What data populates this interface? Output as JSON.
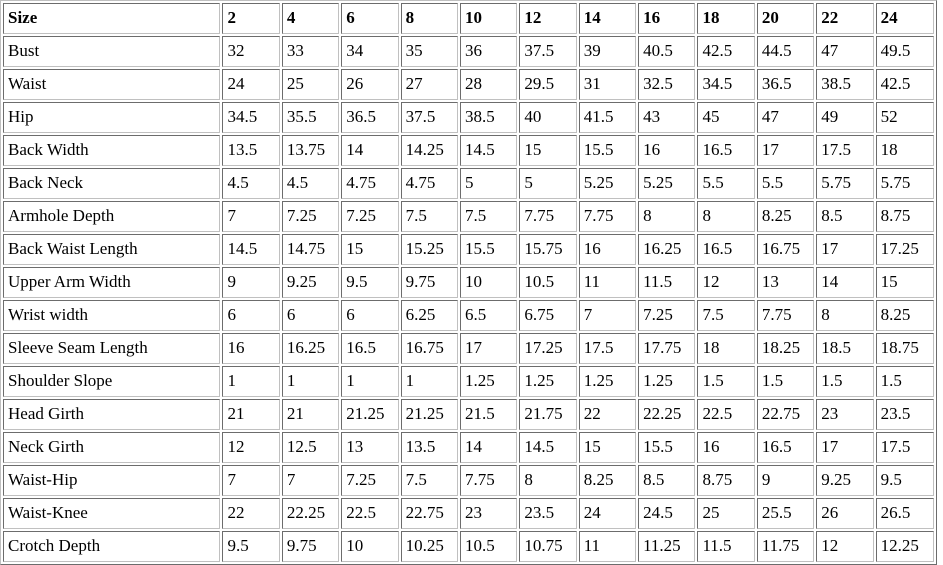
{
  "table": {
    "label_header": "Size",
    "size_headers": [
      "2",
      "4",
      "6",
      "8",
      "10",
      "12",
      "14",
      "16",
      "18",
      "20",
      "22",
      "24"
    ],
    "rows": [
      {
        "label": "Bust",
        "values": [
          "32",
          "33",
          "34",
          "35",
          "36",
          "37.5",
          "39",
          "40.5",
          "42.5",
          "44.5",
          "47",
          "49.5"
        ]
      },
      {
        "label": "Waist",
        "values": [
          "24",
          "25",
          "26",
          "27",
          "28",
          "29.5",
          "31",
          "32.5",
          "34.5",
          "36.5",
          "38.5",
          "42.5"
        ]
      },
      {
        "label": "Hip",
        "values": [
          "34.5",
          "35.5",
          "36.5",
          "37.5",
          "38.5",
          "40",
          "41.5",
          "43",
          "45",
          "47",
          "49",
          "52"
        ]
      },
      {
        "label": "Back Width",
        "values": [
          "13.5",
          "13.75",
          "14",
          "14.25",
          "14.5",
          "15",
          "15.5",
          "16",
          "16.5",
          "17",
          "17.5",
          "18"
        ]
      },
      {
        "label": "Back Neck",
        "values": [
          "4.5",
          "4.5",
          "4.75",
          "4.75",
          "5",
          "5",
          "5.25",
          "5.25",
          "5.5",
          "5.5",
          "5.75",
          "5.75"
        ]
      },
      {
        "label": "Armhole Depth",
        "values": [
          "7",
          "7.25",
          "7.25",
          "7.5",
          "7.5",
          "7.75",
          "7.75",
          "8",
          "8",
          "8.25",
          "8.5",
          "8.75"
        ]
      },
      {
        "label": "Back Waist Length",
        "values": [
          "14.5",
          "14.75",
          "15",
          "15.25",
          "15.5",
          "15.75",
          "16",
          "16.25",
          "16.5",
          "16.75",
          "17",
          "17.25"
        ]
      },
      {
        "label": "Upper Arm Width",
        "values": [
          "9",
          "9.25",
          "9.5",
          "9.75",
          "10",
          "10.5",
          "11",
          "11.5",
          "12",
          "13",
          "14",
          "15"
        ]
      },
      {
        "label": "Wrist width",
        "values": [
          "6",
          "6",
          "6",
          "6.25",
          "6.5",
          "6.75",
          "7",
          "7.25",
          "7.5",
          "7.75",
          "8",
          "8.25"
        ]
      },
      {
        "label": "Sleeve Seam Length",
        "values": [
          "16",
          "16.25",
          "16.5",
          "16.75",
          "17",
          "17.25",
          "17.5",
          "17.75",
          "18",
          "18.25",
          "18.5",
          "18.75"
        ]
      },
      {
        "label": "Shoulder Slope",
        "values": [
          "1",
          "1",
          "1",
          "1",
          "1.25",
          "1.25",
          "1.25",
          "1.25",
          "1.5",
          "1.5",
          "1.5",
          "1.5"
        ]
      },
      {
        "label": "Head Girth",
        "values": [
          "21",
          "21",
          "21.25",
          "21.25",
          "21.5",
          "21.75",
          "22",
          "22.25",
          "22.5",
          "22.75",
          "23",
          "23.5"
        ]
      },
      {
        "label": "Neck Girth",
        "values": [
          "12",
          "12.5",
          "13",
          "13.5",
          "14",
          "14.5",
          "15",
          "15.5",
          "16",
          "16.5",
          "17",
          "17.5"
        ]
      },
      {
        "label": "Waist-Hip",
        "values": [
          "7",
          "7",
          "7.25",
          "7.5",
          "7.75",
          "8",
          "8.25",
          "8.5",
          "8.75",
          "9",
          "9.25",
          "9.5"
        ]
      },
      {
        "label": "Waist-Knee",
        "values": [
          "22",
          "22.25",
          "22.5",
          "22.75",
          "23",
          "23.5",
          "24",
          "24.5",
          "25",
          "25.5",
          "26",
          "26.5"
        ]
      },
      {
        "label": "Crotch Depth",
        "values": [
          "9.5",
          "9.75",
          "10",
          "10.25",
          "10.5",
          "10.75",
          "11",
          "11.25",
          "11.5",
          "11.75",
          "12",
          "12.25"
        ]
      }
    ]
  }
}
